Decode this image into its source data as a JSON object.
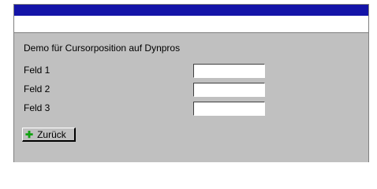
{
  "screen": {
    "heading": "Demo für Cursorposition auf Dynpros"
  },
  "fields": [
    {
      "label": "Feld 1",
      "value": ""
    },
    {
      "label": "Feld 2",
      "value": ""
    },
    {
      "label": "Feld 3",
      "value": ""
    }
  ],
  "buttons": {
    "back": {
      "label": "Zurück",
      "icon": "green-left-arrow-icon"
    }
  },
  "colors": {
    "titlebar": "#1414a8",
    "background": "#c0c0c0",
    "back_icon": "#11a011"
  }
}
